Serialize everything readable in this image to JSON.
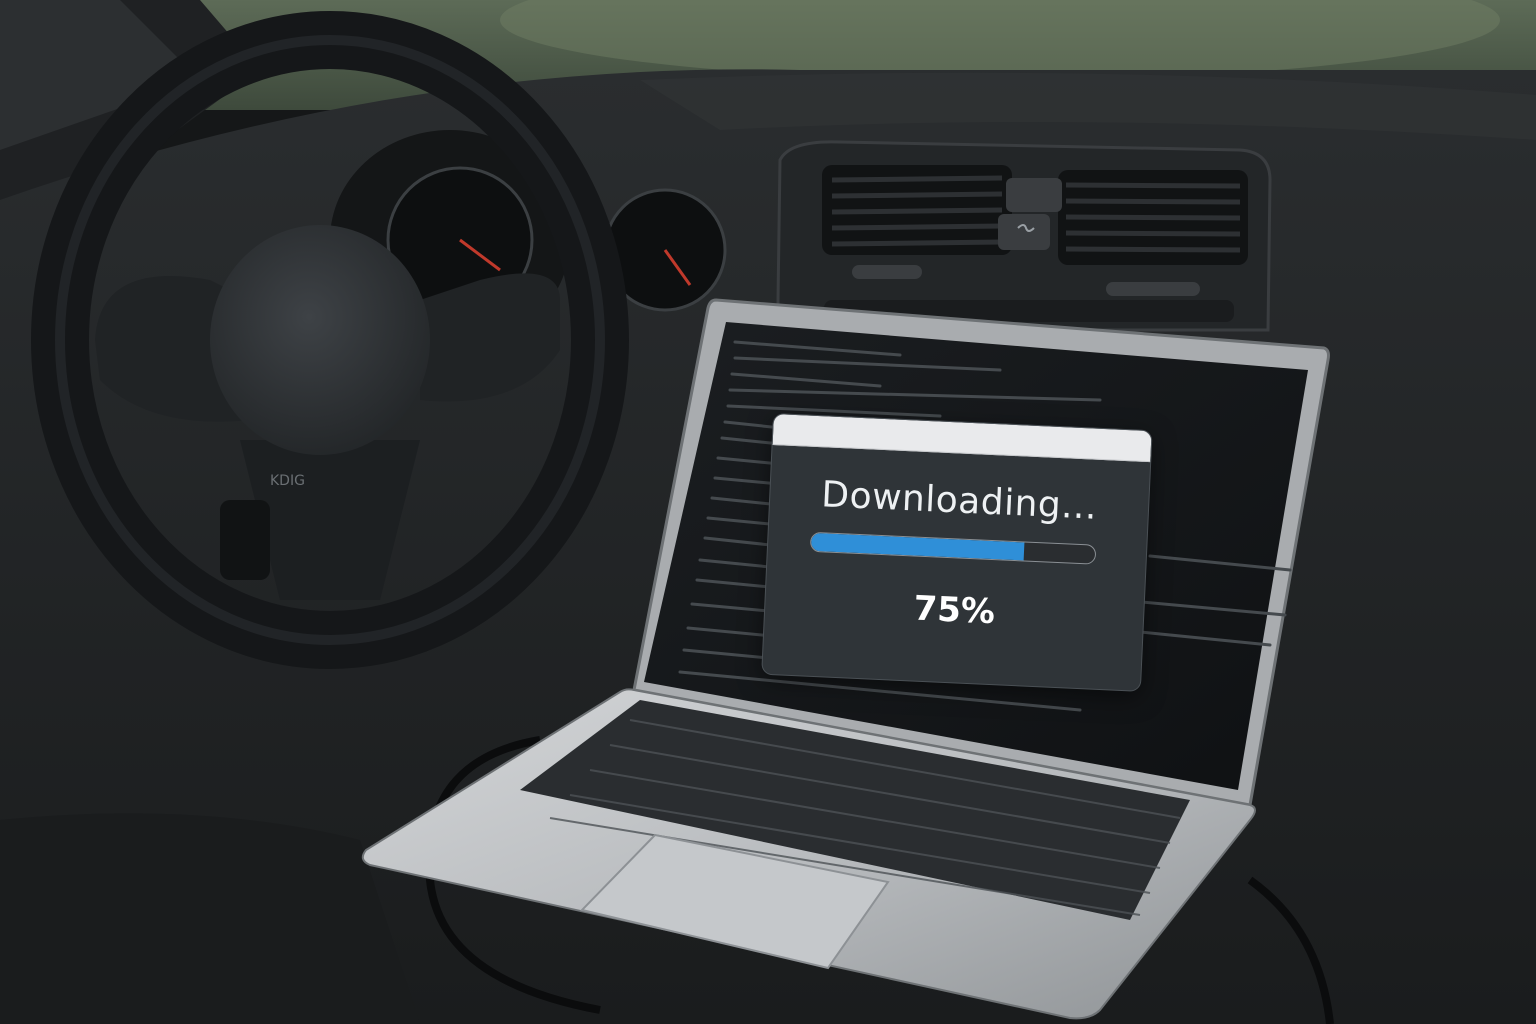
{
  "dialog": {
    "title": "Downloading...",
    "percent_label": "75%",
    "progress": 0.75
  },
  "colors": {
    "progress_fill": "#2f8fd8",
    "dialog_bg": "#2f3438",
    "titlebar_bg": "#e9eaec"
  },
  "icons": {
    "wheel": "steering-wheel-icon"
  }
}
